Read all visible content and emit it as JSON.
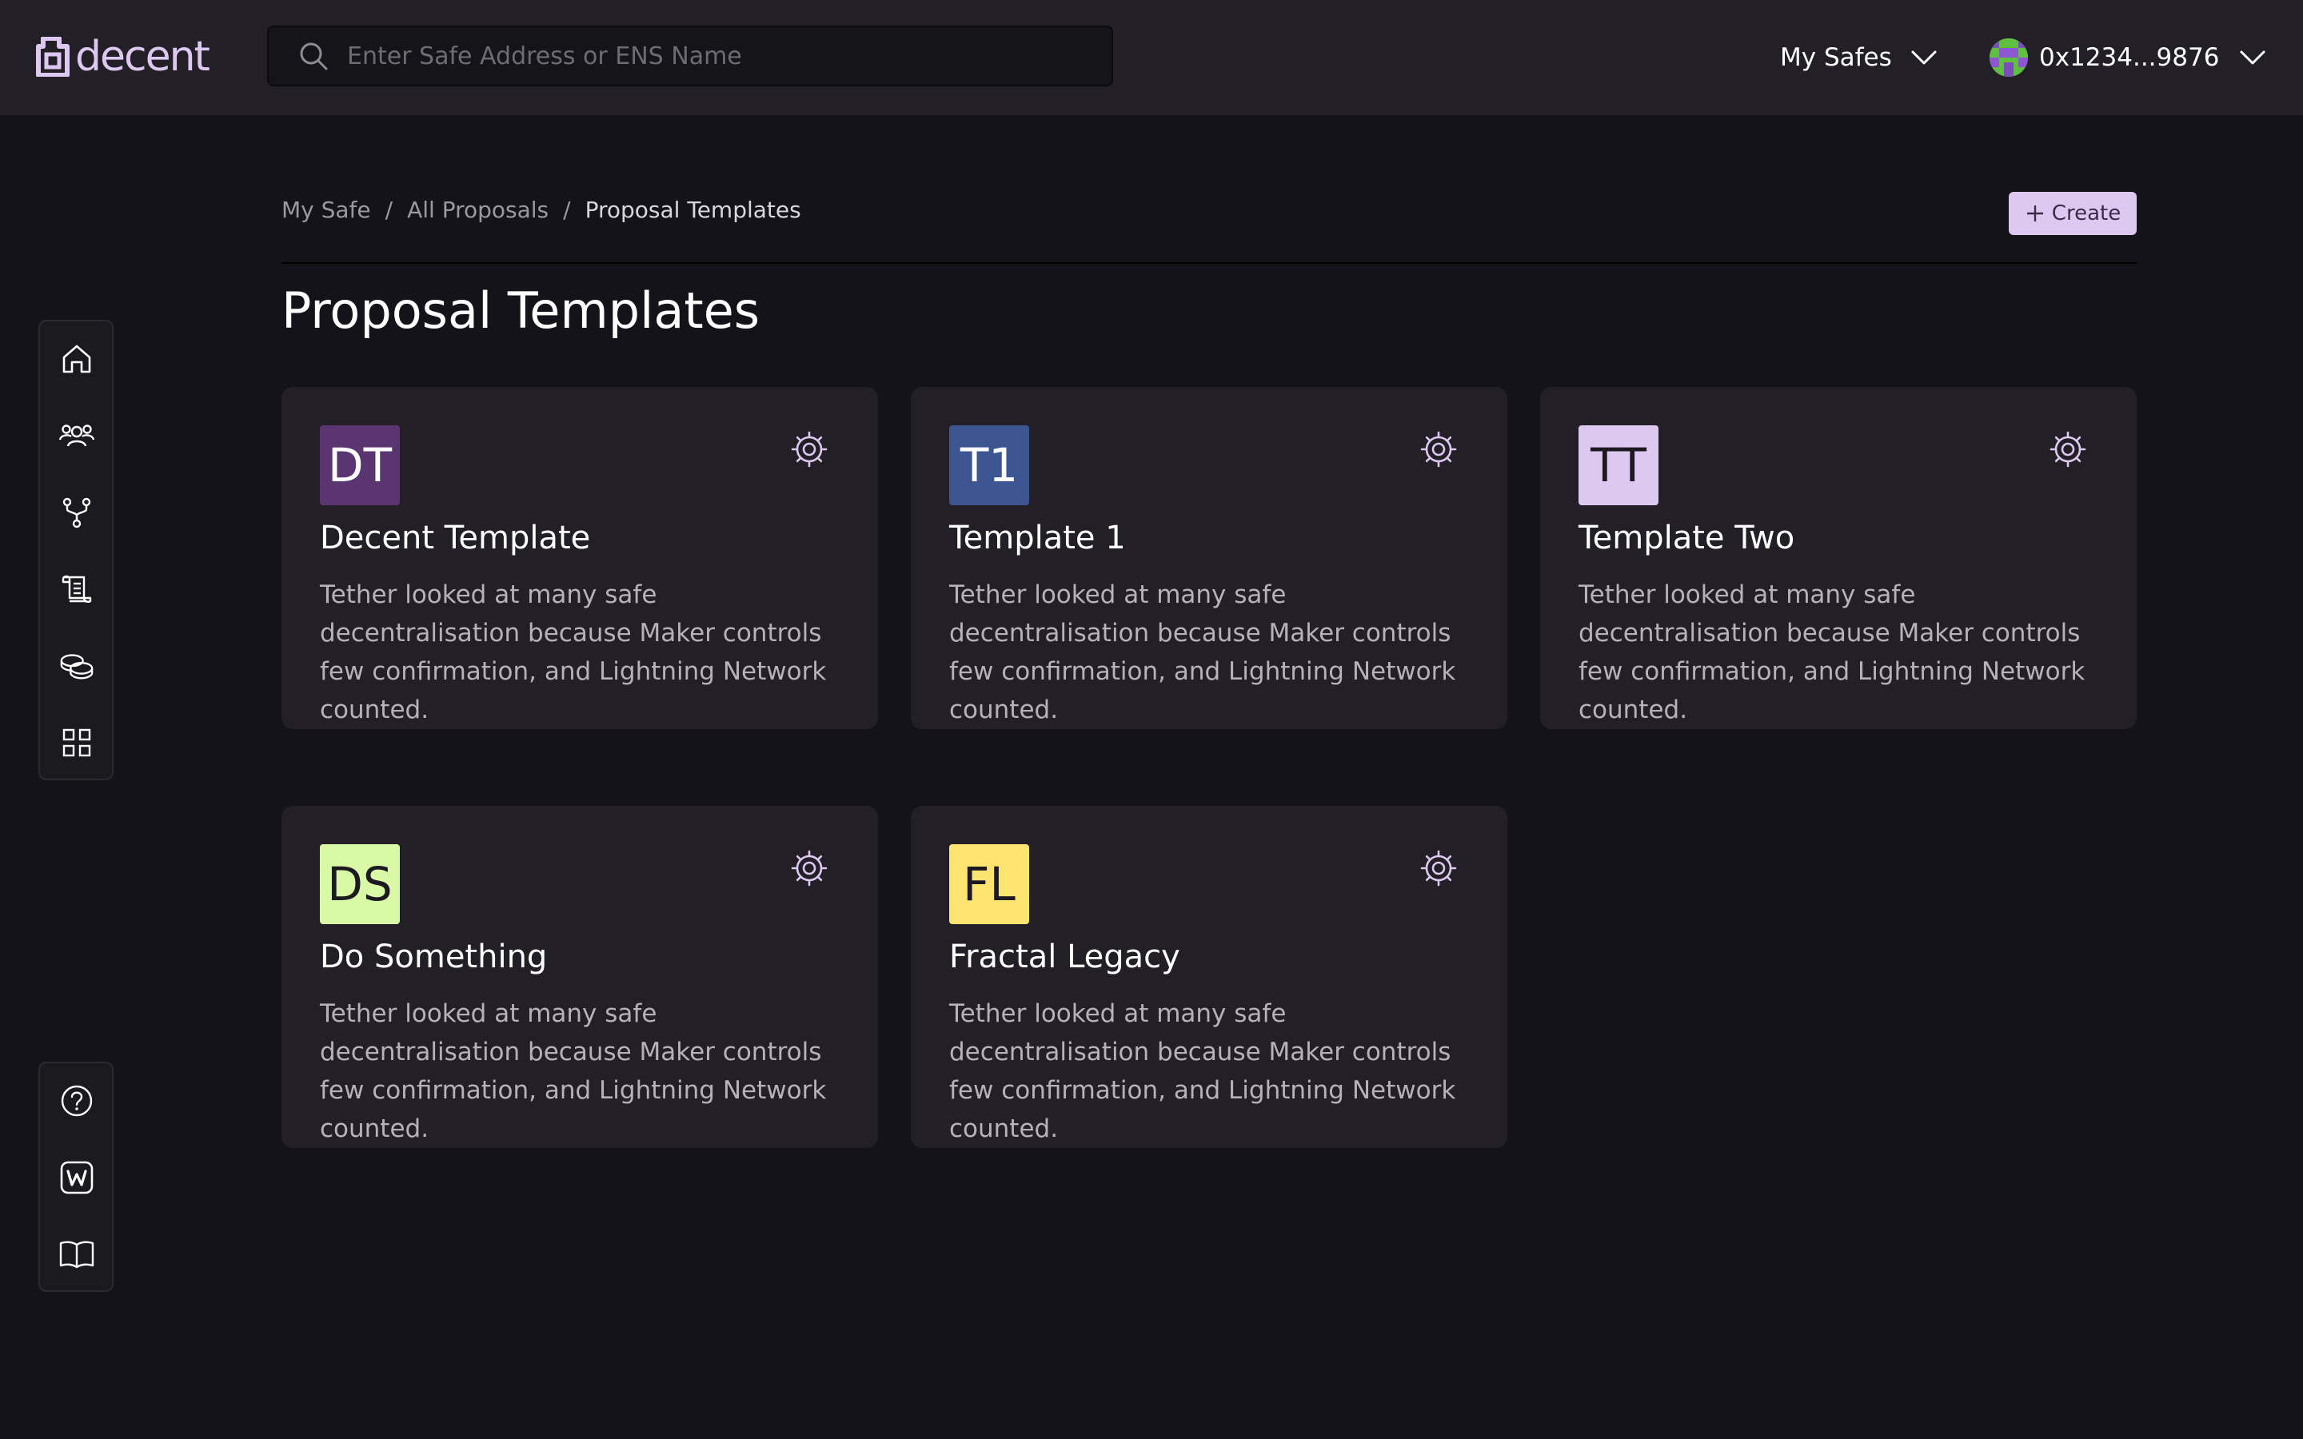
{
  "header": {
    "logo_text": "decent",
    "search_placeholder": "Enter Safe Address or ENS Name",
    "my_safes_label": "My Safes",
    "account_address": "0x1234...9876"
  },
  "sidebar": {
    "items": [
      {
        "name": "home",
        "icon": "home-icon"
      },
      {
        "name": "members",
        "icon": "users-icon"
      },
      {
        "name": "nodes",
        "icon": "fork-icon"
      },
      {
        "name": "proposals",
        "icon": "scroll-icon"
      },
      {
        "name": "treasury",
        "icon": "coins-icon"
      },
      {
        "name": "apps",
        "icon": "grid-icon"
      }
    ],
    "bottom_items": [
      {
        "name": "help",
        "icon": "help-icon"
      },
      {
        "name": "wiki",
        "icon": "wiki-icon"
      },
      {
        "name": "docs",
        "icon": "book-icon"
      }
    ]
  },
  "breadcrumb": {
    "items": [
      "My Safe",
      "All Proposals",
      "Proposal Templates"
    ],
    "separator": "/"
  },
  "create_button_label": "Create",
  "page_title": "Proposal Templates",
  "colors": {
    "accent": "#dcc8f0",
    "background": "#15131a",
    "surface": "#221f26"
  },
  "templates": [
    {
      "initials": "DT",
      "title": "Decent Template",
      "description": "Tether looked at many safe decentralisation because Maker controls few confirmation, and Lightning Network counted.",
      "badge_color": "#5b3472",
      "badge_text_color": "#ffffff"
    },
    {
      "initials": "T1",
      "title": "Template 1",
      "description": "Tether looked at many safe decentralisation because Maker controls few confirmation, and Lightning Network counted.",
      "badge_color": "#3d5591",
      "badge_text_color": "#ffffff"
    },
    {
      "initials": "TT",
      "title": "Template Two",
      "description": "Tether looked at many safe decentralisation because Maker controls few confirmation, and Lightning Network counted.",
      "badge_color": "#dcc8f0",
      "badge_text_color": "#1c1a20"
    },
    {
      "initials": "DS",
      "title": "Do Something",
      "description": "Tether looked at many safe decentralisation because Maker controls few confirmation, and Lightning Network counted.",
      "badge_color": "#d9f9a6",
      "badge_text_color": "#1c1a20"
    },
    {
      "initials": "FL",
      "title": "Fractal Legacy",
      "description": "Tether looked at many safe decentralisation because Maker controls few confirmation, and Lightning Network counted.",
      "badge_color": "#fde370",
      "badge_text_color": "#1c1a20"
    }
  ]
}
